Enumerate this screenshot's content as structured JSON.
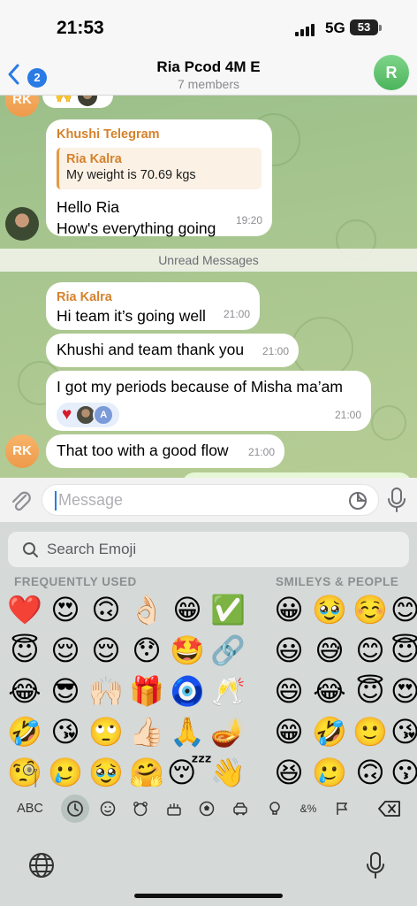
{
  "status_bar": {
    "time": "21:53",
    "network": "5G",
    "battery": "53"
  },
  "header": {
    "back_badge": "2",
    "title": "Ria Pcod 4M E",
    "subtitle": "7 members",
    "avatar_letter": "R"
  },
  "chat": {
    "messages": [
      {
        "sender": "Khushi Telegram",
        "reply_to": {
          "name": "Ria Kalra",
          "text": "My weight is 70.69 kgs"
        },
        "lines": [
          "Hello Ria",
          "How's everything going"
        ],
        "time": "19:20"
      },
      {
        "sender": "Ria Kalra",
        "text": "Hi team it’s going well",
        "time": "21:00"
      },
      {
        "text": "Khushi and team thank you",
        "time": "21:00"
      },
      {
        "text": "I got my periods because of Misha ma’am",
        "time": "21:00",
        "reaction_avatar_letter": "A"
      },
      {
        "text": "That too with a good flow",
        "time": "21:00"
      }
    ],
    "avatar_initials": "RK",
    "unread_label": "Unread Messages"
  },
  "input": {
    "placeholder": "Message"
  },
  "emoji_keyboard": {
    "search_placeholder": "Search Emoji",
    "section_frequent": "FREQUENTLY USED",
    "section_smileys": "SMILEYS & PEOPLE",
    "frequent": [
      [
        "❤️",
        "😍",
        "🙃",
        "👌🏻",
        "😁",
        "✅"
      ],
      [
        "😇",
        "😌",
        "😌",
        "😯",
        "🤩",
        "🔗"
      ],
      [
        "😂",
        "😎",
        "🙌🏻",
        "🎁",
        "🧿",
        "🥂"
      ],
      [
        "🤣",
        "😘",
        "🙄",
        "👍🏻",
        "🙏",
        "🪔"
      ],
      [
        "🧐",
        "🥲",
        "🥹",
        "🤗",
        "😴",
        "👋"
      ]
    ],
    "smileys": [
      [
        "😀",
        "🥹",
        "☺️",
        "😊"
      ],
      [
        "😃",
        "😅",
        "😊",
        "😇"
      ],
      [
        "😄",
        "😂",
        "😇",
        "😍"
      ],
      [
        "😁",
        "🤣",
        "🙂",
        "😘"
      ],
      [
        "😆",
        "🥲",
        "🙃",
        "😗"
      ]
    ],
    "abc_label": "ABC",
    "category_icons": [
      "recent-icon",
      "smiley-icon",
      "animal-icon",
      "food-icon",
      "ball-icon",
      "car-icon",
      "bulb-icon",
      "symbols-icon",
      "flag-icon"
    ]
  },
  "colors": {
    "accent": "#2a7be4",
    "sender_name": "#d5822c",
    "chat_background": "#a8c68f"
  }
}
